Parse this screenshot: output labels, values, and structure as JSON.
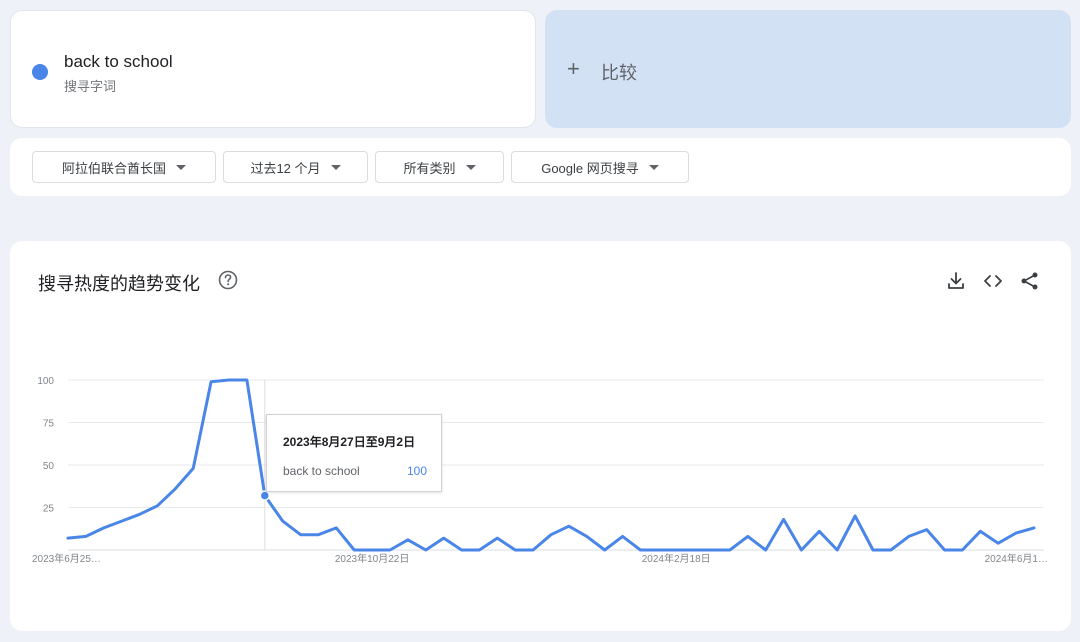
{
  "term": {
    "name": "back to school",
    "subtitle": "搜寻字词",
    "color": "#4a86e8"
  },
  "compare": {
    "plus": "+",
    "label": "比较"
  },
  "filters": [
    {
      "label": "阿拉伯联合酋长国"
    },
    {
      "label": "过去12 个月"
    },
    {
      "label": "所有类别"
    },
    {
      "label": "Google 网页搜寻"
    }
  ],
  "chart": {
    "title": "搜寻热度的趋势变化",
    "icons": [
      "help-icon",
      "download-icon",
      "embed-icon",
      "share-icon"
    ]
  },
  "tooltip": {
    "date": "2023年8月27日至9月2日",
    "term": "back to school",
    "value": "100"
  },
  "chart_data": {
    "type": "line",
    "title": "",
    "xlabel": "",
    "ylabel": "",
    "ylim": [
      0,
      100
    ],
    "yticks": [
      "100",
      "75",
      "50",
      "25"
    ],
    "xtick_labels": [
      "2023年6月25…",
      "2023年10月22日",
      "2024年2月18日",
      "2024年6月1…"
    ],
    "xtick_indices": [
      0,
      17,
      34,
      51
    ],
    "grid": true,
    "highlight_index": 11,
    "series": [
      {
        "name": "back to school",
        "color": "#4a86e8",
        "values": [
          7,
          8,
          13,
          17,
          21,
          26,
          36,
          48,
          99,
          100,
          100,
          32,
          17,
          9,
          9,
          13,
          0,
          0,
          0,
          6,
          0,
          7,
          0,
          0,
          7,
          0,
          0,
          9,
          14,
          8,
          0,
          8,
          0,
          0,
          0,
          0,
          0,
          0,
          8,
          0,
          18,
          0,
          11,
          0,
          20,
          0,
          0,
          8,
          12,
          0,
          0,
          11,
          4,
          10,
          13
        ]
      }
    ]
  }
}
